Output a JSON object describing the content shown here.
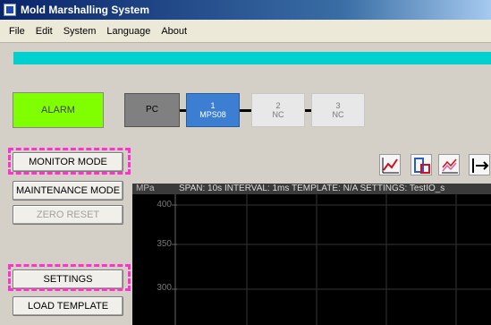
{
  "window": {
    "title": "Mold Marshalling System"
  },
  "menu": [
    "File",
    "Edit",
    "System",
    "Language",
    "About"
  ],
  "colors": {
    "accent_bar": "#00d0d0",
    "alarm": "#80ff00",
    "node_active": "#3c7fd2",
    "highlight": "#ff33cc"
  },
  "alarm": {
    "label": "ALARM"
  },
  "nodes": {
    "pc": {
      "label": "PC"
    },
    "n1": {
      "num": "1",
      "label": "MPS08"
    },
    "n2": {
      "num": "2",
      "label": "NC"
    },
    "n3": {
      "num": "3",
      "label": "NC"
    }
  },
  "buttons": {
    "monitor": "MONITOR MODE",
    "maintenance": "MAINTENANCE MODE",
    "zero_reset": "ZERO RESET",
    "settings": "SETTINGS",
    "load_template": "LOAD TEMPLATE"
  },
  "toolbar_icons": [
    "line-chart-icon",
    "window-chart-icon",
    "multi-line-chart-icon",
    "span-arrows-icon"
  ],
  "chart": {
    "unit": "MPa",
    "info": "SPAN: 10s  INTERVAL: 1ms  TEMPLATE: N/A  SETTINGS: TestIO_s",
    "y_ticks": [
      "400",
      "350",
      "300"
    ]
  }
}
